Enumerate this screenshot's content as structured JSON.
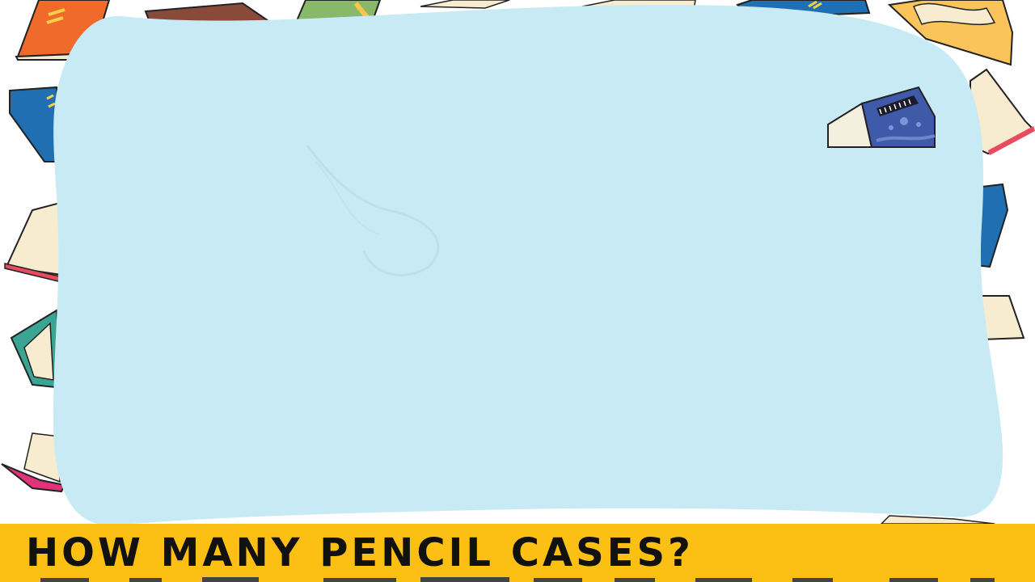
{
  "caption": {
    "text": "HOW MANY PENCIL CASES?"
  },
  "colors": {
    "board": "#c8eaf5",
    "caption_bar": "#fbc013",
    "caption_text": "#111111",
    "background": "#ffffff"
  },
  "icons": {
    "eraser": "eraser-icon",
    "books": "book-icon"
  }
}
